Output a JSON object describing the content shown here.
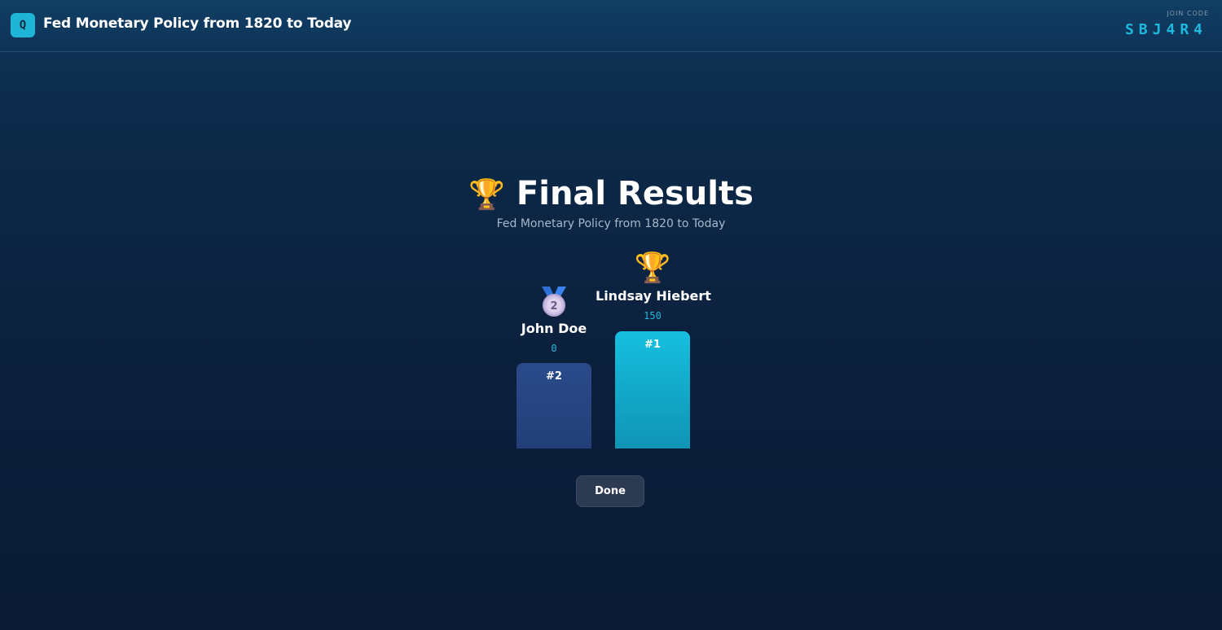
{
  "header": {
    "logo_letter": "Q",
    "title": "Fed Monetary Policy from 1820 to Today",
    "join_label": "JOIN CODE",
    "join_code": "SBJ4R4"
  },
  "results": {
    "title_icon": "🏆",
    "title": "Final Results",
    "subtitle": "Fed Monetary Policy from 1820 to Today"
  },
  "podium": [
    {
      "rank_label": "#1",
      "name": "Lindsay Hiebert",
      "score": "150",
      "icon": "trophy-icon"
    },
    {
      "rank_label": "#2",
      "name": "John Doe",
      "score": "0",
      "icon": "second-place-medal-icon",
      "medal_number": "2"
    }
  ],
  "actions": {
    "done_label": "Done"
  },
  "colors": {
    "accent": "#1fb8de",
    "first_bar": "#17bfe0",
    "second_bar": "#2a4a8a",
    "button": "#2c3b52"
  }
}
